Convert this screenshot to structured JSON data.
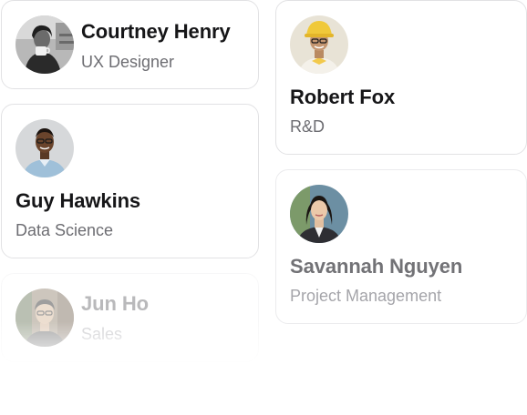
{
  "people": [
    {
      "name": "Courtney Henry",
      "role": "UX Designer"
    },
    {
      "name": "Guy Hawkins",
      "role": "Data Science"
    },
    {
      "name": "Jun Ho",
      "role": "Sales"
    },
    {
      "name": "Robert Fox",
      "role": "R&D"
    },
    {
      "name": "Savannah Nguyen",
      "role": "Project Management"
    }
  ]
}
